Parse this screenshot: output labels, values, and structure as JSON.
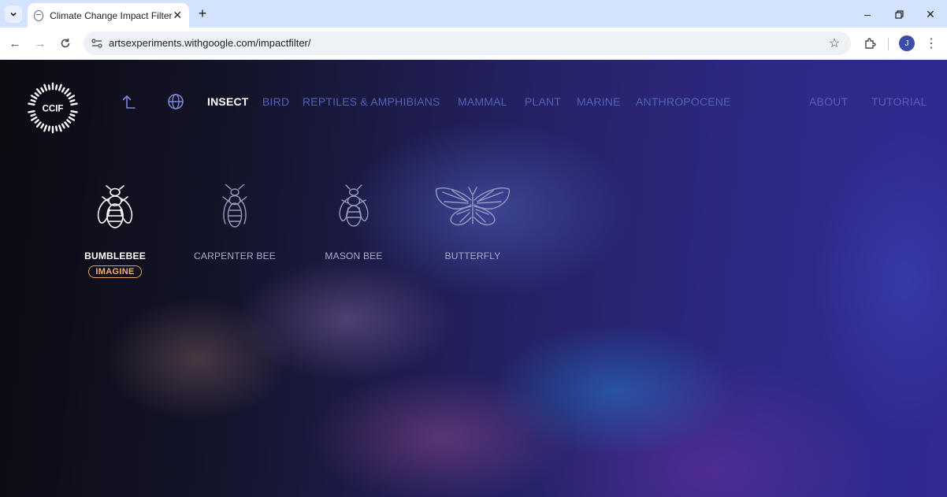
{
  "browser": {
    "tab_title": "Climate Change Impact Filter",
    "url": "artsexperiments.withgoogle.com/impactfilter/",
    "profile_initial": "J"
  },
  "app": {
    "logo_text": "CCIF",
    "nav": {
      "active": "INSECT",
      "categories": [
        "BIRD",
        "REPTILES & AMPHIBIANS",
        "MAMMAL",
        "PLANT",
        "MARINE",
        "ANTHROPOCENE"
      ],
      "about": "ABOUT",
      "tutorial": "TUTORIAL"
    },
    "species": [
      {
        "name": "BUMBLEBEE",
        "badge": "IMAGINE",
        "selected": true,
        "icon": "bumblebee-icon"
      },
      {
        "name": "CARPENTER BEE",
        "selected": false,
        "icon": "carpenter-bee-icon"
      },
      {
        "name": "MASON BEE",
        "selected": false,
        "icon": "mason-bee-icon"
      },
      {
        "name": "BUTTERFLY",
        "selected": false,
        "icon": "butterfly-icon"
      }
    ]
  },
  "colors": {
    "accent_badge": "#f0b16a",
    "nav_dim": "#5460b8",
    "nav_active": "#ffffff"
  }
}
